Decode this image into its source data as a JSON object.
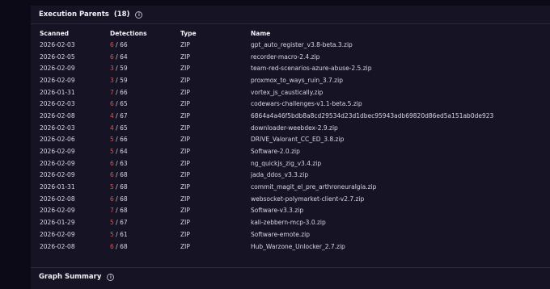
{
  "parents": {
    "title": "Execution Parents",
    "count": "(18)",
    "columns": {
      "scanned": "Scanned",
      "detections": "Detections",
      "type": "Type",
      "name": "Name"
    },
    "rows": [
      {
        "scanned": "2026-02-03",
        "pos": "6",
        "total": "66",
        "type": "ZIP",
        "name": "gpt_auto_register_v3.8-beta.3.zip"
      },
      {
        "scanned": "2026-02-05",
        "pos": "6",
        "total": "64",
        "type": "ZIP",
        "name": "recorder-macro-2.4.zip"
      },
      {
        "scanned": "2026-02-09",
        "pos": "3",
        "total": "59",
        "type": "ZIP",
        "name": "team-red-scenarios-azure-abuse-2.5.zip"
      },
      {
        "scanned": "2026-02-09",
        "pos": "3",
        "total": "59",
        "type": "ZIP",
        "name": "proxmox_to_ways_ruin_3.7.zip"
      },
      {
        "scanned": "2026-01-31",
        "pos": "7",
        "total": "66",
        "type": "ZIP",
        "name": "vortex_js_caustically.zip"
      },
      {
        "scanned": "2026-02-03",
        "pos": "6",
        "total": "65",
        "type": "ZIP",
        "name": "codewars-challenges-v1.1-beta.5.zip"
      },
      {
        "scanned": "2026-02-08",
        "pos": "4",
        "total": "67",
        "type": "ZIP",
        "name": "6864a4a46f5bdb8a8cd29534d23d1dbec95943adb69820d86ed5a151ab0de923"
      },
      {
        "scanned": "2026-02-03",
        "pos": "4",
        "total": "65",
        "type": "ZIP",
        "name": "downloader-weebdex-2.9.zip"
      },
      {
        "scanned": "2026-02-06",
        "pos": "5",
        "total": "66",
        "type": "ZIP",
        "name": "DRIVE_Valorant_CC_ED_3.8.zip"
      },
      {
        "scanned": "2026-02-09",
        "pos": "5",
        "total": "64",
        "type": "ZIP",
        "name": "Software-2.0.zip"
      },
      {
        "scanned": "2026-02-09",
        "pos": "6",
        "total": "63",
        "type": "ZIP",
        "name": "ng_quickjs_zig_v3.4.zip"
      },
      {
        "scanned": "2026-02-09",
        "pos": "6",
        "total": "68",
        "type": "ZIP",
        "name": "jada_ddos_v3.3.zip"
      },
      {
        "scanned": "2026-01-31",
        "pos": "5",
        "total": "68",
        "type": "ZIP",
        "name": "commit_magit_el_pre_arthroneuralgia.zip"
      },
      {
        "scanned": "2026-02-08",
        "pos": "6",
        "total": "68",
        "type": "ZIP",
        "name": "websocket-polymarket-client-v2.7.zip"
      },
      {
        "scanned": "2026-02-09",
        "pos": "7",
        "total": "68",
        "type": "ZIP",
        "name": "Software-v3.3.zip"
      },
      {
        "scanned": "2026-01-29",
        "pos": "5",
        "total": "67",
        "type": "ZIP",
        "name": "kali-zebbern-mcp-3.0.zip"
      },
      {
        "scanned": "2026-02-09",
        "pos": "5",
        "total": "61",
        "type": "ZIP",
        "name": "Software-emote.zip"
      },
      {
        "scanned": "2026-02-08",
        "pos": "6",
        "total": "68",
        "type": "ZIP",
        "name": "Hub_Warzone_Unlocker_2.7.zip"
      }
    ]
  },
  "graph": {
    "title": "Graph Summary"
  },
  "ui": {
    "info_glyph": "i",
    "separator": "/"
  },
  "colors": {
    "detection_positive": "#e8504d",
    "background": "#0c0a17",
    "panel": "#161424"
  }
}
